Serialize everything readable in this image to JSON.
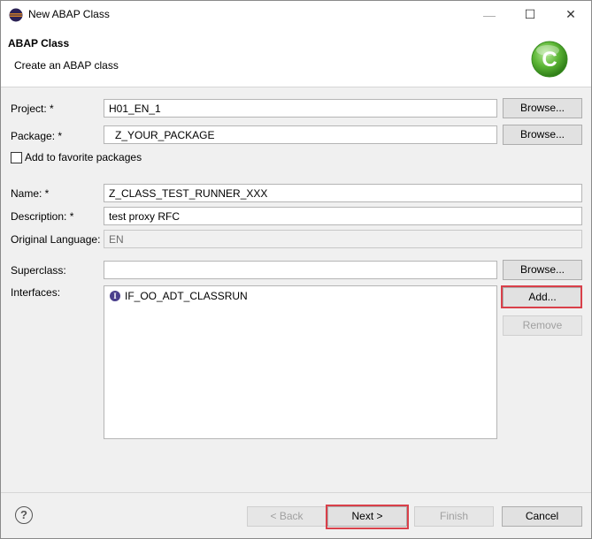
{
  "window": {
    "title": "New ABAP Class"
  },
  "header": {
    "title": "ABAP Class",
    "subtitle": "Create an ABAP class"
  },
  "form": {
    "project": {
      "label": "Project: *",
      "value": "H01_EN_1",
      "browse": "Browse..."
    },
    "package": {
      "label": "Package: *",
      "value": "Z_YOUR_PACKAGE",
      "browse": "Browse..."
    },
    "favorite": {
      "label": "Add to favorite packages",
      "checked": false
    },
    "name": {
      "label": "Name: *",
      "value": "Z_CLASS_TEST_RUNNER_XXX"
    },
    "description": {
      "label": "Description: *",
      "value": "test proxy RFC"
    },
    "original_language": {
      "label": "Original Language:",
      "value": "EN"
    },
    "superclass": {
      "label": "Superclass:",
      "value": "",
      "browse": "Browse..."
    },
    "interfaces": {
      "label": "Interfaces:",
      "items": [
        "IF_OO_ADT_CLASSRUN"
      ],
      "add": "Add...",
      "remove": "Remove"
    }
  },
  "footer": {
    "back": "< Back",
    "next": "Next >",
    "finish": "Finish",
    "cancel": "Cancel",
    "help": "?"
  },
  "colors": {
    "highlight": "#d9404a",
    "brand_green": "#6cc04a"
  }
}
